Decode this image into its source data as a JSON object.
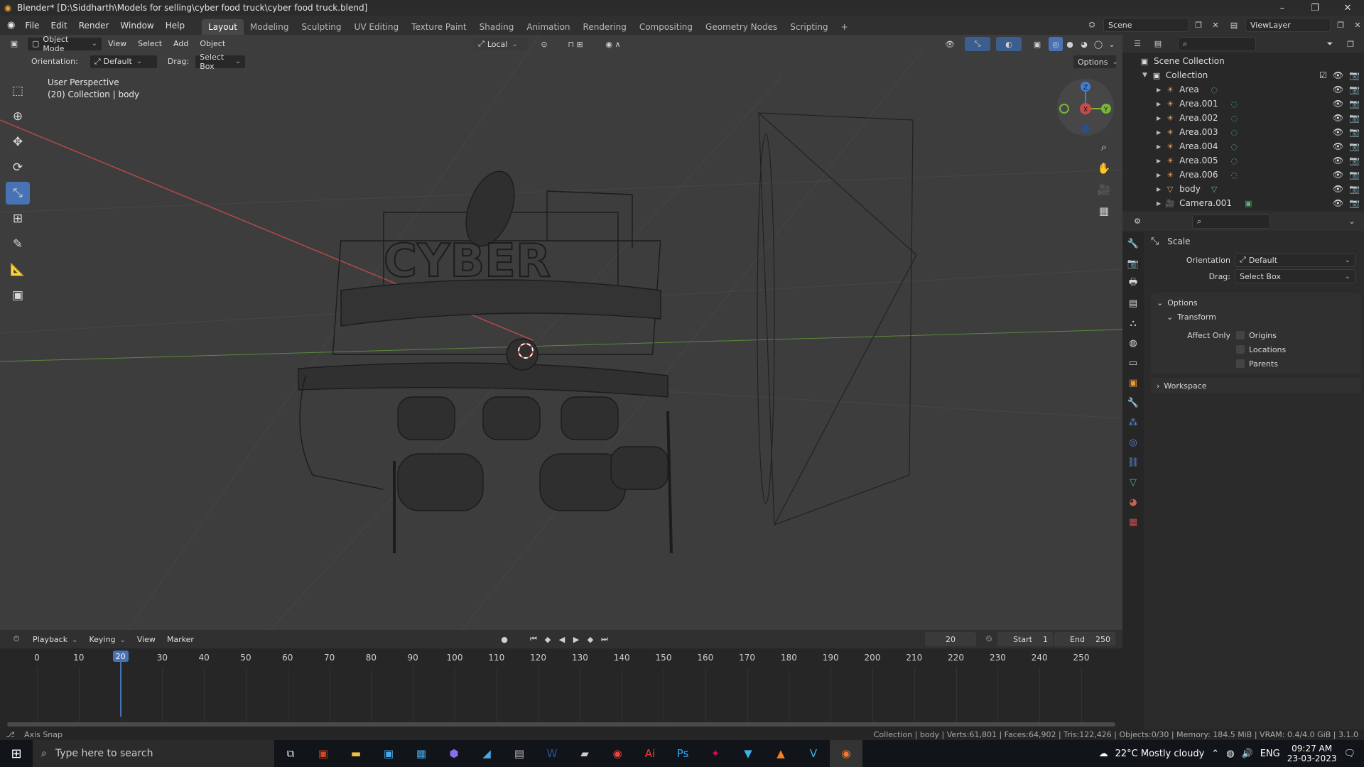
{
  "window": {
    "title": "Blender* [D:\\Siddharth\\Models for selling\\cyber food truck\\cyber food truck.blend]",
    "controls": [
      "–",
      "❐",
      "✕"
    ]
  },
  "menubar": {
    "items": [
      "File",
      "Edit",
      "Render",
      "Window",
      "Help"
    ],
    "workspaces": [
      "Layout",
      "Modeling",
      "Sculpting",
      "UV Editing",
      "Texture Paint",
      "Shading",
      "Animation",
      "Rendering",
      "Compositing",
      "Geometry Nodes",
      "Scripting"
    ],
    "active_workspace": "Layout",
    "add_workspace": "+",
    "scene_label": "Scene",
    "viewlayer_label": "ViewLayer"
  },
  "viewport_header": {
    "mode": "Object Mode",
    "menus": [
      "View",
      "Select",
      "Add",
      "Object"
    ],
    "transform_orientation": "Local",
    "options_label": "Options"
  },
  "tool_header": {
    "orientation_label": "Orientation:",
    "orientation_value": "Default",
    "drag_label": "Drag:",
    "drag_value": "Select Box"
  },
  "viewport_overlay": {
    "line1": "User Perspective",
    "line2": "(20) Collection | body"
  },
  "truck_sign": "CYBER",
  "gizmo": {
    "x": "X",
    "y": "Y",
    "z": "Z"
  },
  "outliner": {
    "search_placeholder": "",
    "root": "Scene Collection",
    "collection": "Collection",
    "items": [
      {
        "name": "Area",
        "type": "light"
      },
      {
        "name": "Area.001",
        "type": "light"
      },
      {
        "name": "Area.002",
        "type": "light"
      },
      {
        "name": "Area.003",
        "type": "light"
      },
      {
        "name": "Area.004",
        "type": "light"
      },
      {
        "name": "Area.005",
        "type": "light"
      },
      {
        "name": "Area.006",
        "type": "light"
      },
      {
        "name": "body",
        "type": "mesh"
      },
      {
        "name": "Camera.001",
        "type": "camera"
      }
    ]
  },
  "properties": {
    "tool_name": "Scale",
    "orientation_label": "Orientation",
    "orientation_value": "Default",
    "drag_label": "Drag:",
    "drag_value": "Select Box",
    "options_panel": "Options",
    "transform_panel": "Transform",
    "affect_only_label": "Affect Only",
    "checkboxes": [
      "Origins",
      "Locations",
      "Parents"
    ],
    "workspace_panel": "Workspace"
  },
  "timeline": {
    "menus": [
      "Playback",
      "Keying",
      "View",
      "Marker"
    ],
    "current_frame": "20",
    "start_label": "Start",
    "start_value": "1",
    "end_label": "End",
    "end_value": "250",
    "ticks": [
      "0",
      "10",
      "20",
      "30",
      "40",
      "50",
      "60",
      "70",
      "80",
      "90",
      "100",
      "110",
      "120",
      "130",
      "140",
      "150",
      "160",
      "170",
      "180",
      "190",
      "200",
      "210",
      "220",
      "230",
      "240",
      "250"
    ],
    "frame_playhead": "20"
  },
  "statusbar": {
    "left": "Axis Snap",
    "right": "Collection | body | Verts:61,801 | Faces:64,902 | Tris:122,426 | Objects:0/30 | Memory: 184.5 MiB | VRAM: 0.4/4.0 GiB | 3.1.0"
  },
  "taskbar": {
    "search_placeholder": "Type here to search",
    "weather": "22°C  Mostly cloudy",
    "lang": "ENG",
    "time": "09:27 AM",
    "date": "23-03-2023"
  },
  "colors": {
    "accent": "#4772b3",
    "header_bg": "#303030",
    "viewport_bg": "#3d3d3d",
    "x_axis": "#c94a4a",
    "y_axis": "#7bb53a",
    "z_axis": "#3f7fd6"
  }
}
